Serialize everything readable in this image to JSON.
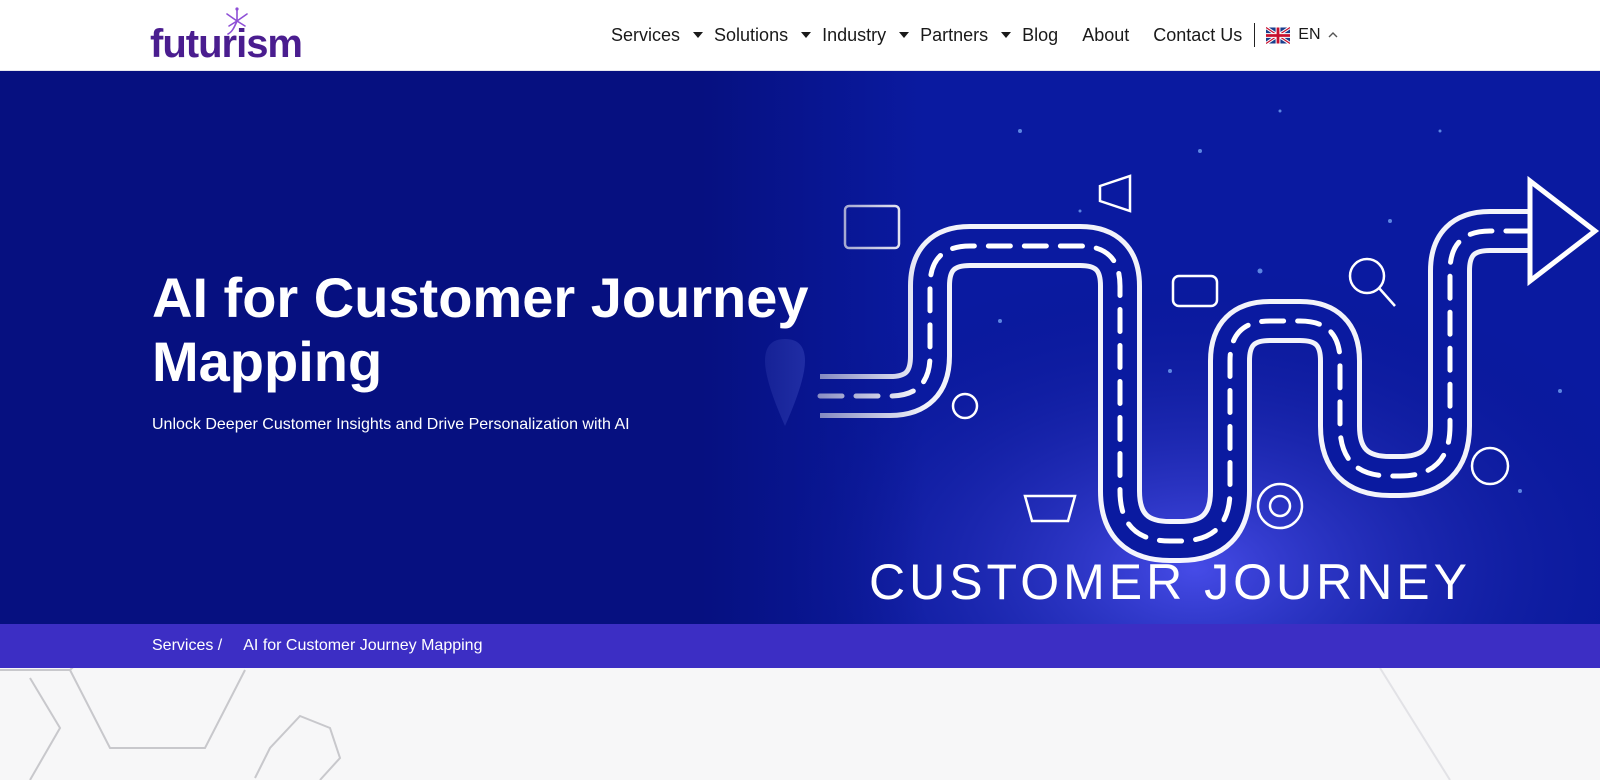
{
  "brand": {
    "logo_text": "futurism",
    "color": "#4a1d8f"
  },
  "nav": {
    "items": [
      {
        "label": "Services",
        "dropdown": true
      },
      {
        "label": "Solutions",
        "dropdown": true
      },
      {
        "label": "Industry",
        "dropdown": true
      },
      {
        "label": "Partners",
        "dropdown": true
      },
      {
        "label": "Blog",
        "dropdown": false
      },
      {
        "label": "About",
        "dropdown": false
      },
      {
        "label": "Contact Us",
        "dropdown": false
      }
    ],
    "language": {
      "code": "EN",
      "flag_icon": "uk-flag-icon"
    }
  },
  "hero": {
    "title": "AI for Customer Journey Mapping",
    "subtitle": "Unlock Deeper Customer Insights and Drive Personalization with AI",
    "image_caption": "CUSTOMER  JOURNEY",
    "background": "#061080"
  },
  "breadcrumb": {
    "parent": "Services /",
    "current": "AI for Customer Journey Mapping",
    "background": "#3c2ec4"
  }
}
